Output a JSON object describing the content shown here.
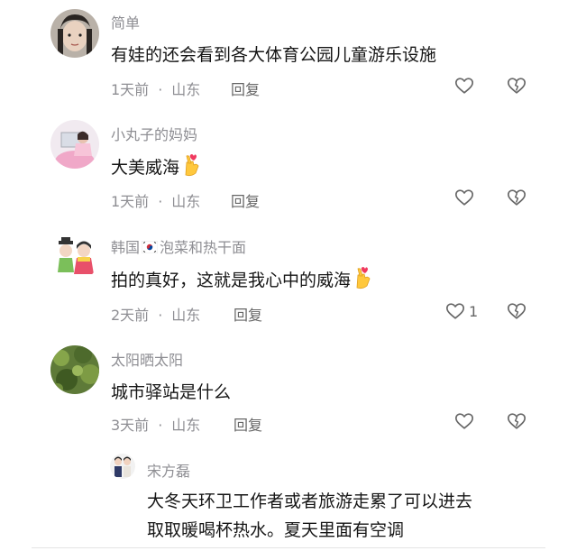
{
  "comments": [
    {
      "username": "简单",
      "text": "有娃的还会看到各大体育公园儿童游乐设施",
      "time": "1天前",
      "location": "山东",
      "reply_label": "回复",
      "likes": ""
    },
    {
      "username": "小丸子的妈妈",
      "text": "大美威海",
      "time": "1天前",
      "location": "山东",
      "reply_label": "回复",
      "likes": ""
    },
    {
      "username_prefix": "韩国",
      "username_suffix": "泡菜和热干面",
      "text": "拍的真好，这就是我心中的威海",
      "time": "2天前",
      "location": "山东",
      "reply_label": "回复",
      "likes": "1"
    },
    {
      "username": "太阳晒太阳",
      "text": "城市驿站是什么",
      "time": "3天前",
      "location": "山东",
      "reply_label": "回复",
      "likes": ""
    }
  ],
  "reply": {
    "username": "宋方磊",
    "text_line1": "大冬天环卫工作者或者旅游走累了可以进去",
    "text_line2": "取取暖喝杯热水。夏天里面有空调"
  },
  "colors": {
    "text": "#161616",
    "meta": "#8e8e93",
    "icon": "#666666"
  }
}
